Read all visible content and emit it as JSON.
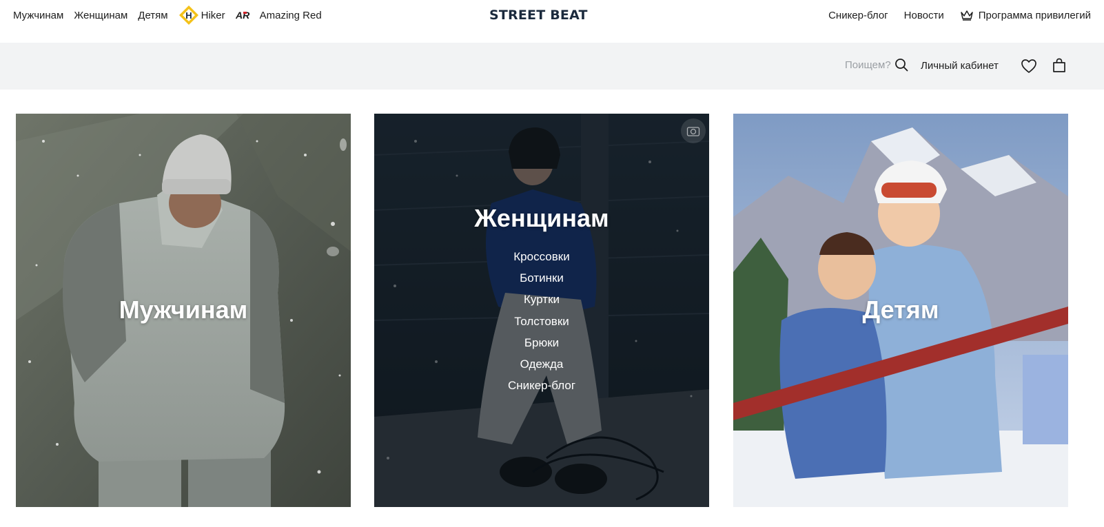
{
  "nav_left": {
    "men": "Мужчинам",
    "women": "Женщинам",
    "kids": "Детям",
    "hiker": "Hiker",
    "hiker_mark": "H",
    "amazing_red": "Amazing Red",
    "amazing_red_mark": "AR"
  },
  "logo": "STREET BEAT",
  "nav_right": {
    "sneaker_blog": "Сникер-блог",
    "news": "Новости",
    "privileges": "Программа привилегий"
  },
  "search": {
    "placeholder": "Поищем?"
  },
  "account": "Личный кабинет",
  "cards": {
    "men": {
      "title": "Мужчинам"
    },
    "women": {
      "title": "Женщинам",
      "links": [
        "Кроссовки",
        "Ботинки",
        "Куртки",
        "Толстовки",
        "Брюки",
        "Одежда",
        "Сникер-блог"
      ]
    },
    "kids": {
      "title": "Детям"
    }
  },
  "colors": {
    "logo": "#1b2a3d",
    "graybar": "#f2f3f4",
    "hiker_yellow": "#f4c21a",
    "ar_red": "#d3232a"
  },
  "icons": [
    "hiker-logo",
    "amazing-red-logo",
    "crown-icon",
    "search-icon",
    "heart-icon",
    "bag-icon",
    "camera-icon"
  ]
}
